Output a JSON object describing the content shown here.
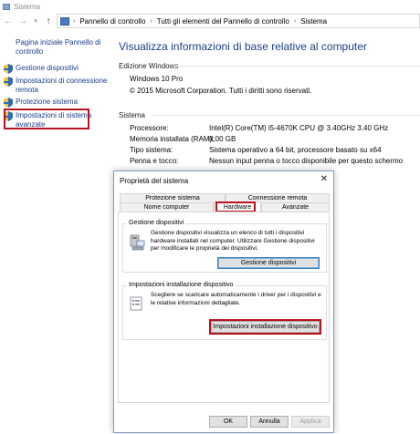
{
  "window": {
    "title": "Sistema"
  },
  "breadcrumb": {
    "items": [
      "Pannello di controllo",
      "Tutti gli elementi del Pannello di controllo",
      "Sistema"
    ]
  },
  "left": {
    "home": "Pagina iniziale Pannello di controllo",
    "links": [
      "Gestione dispositivi",
      "Impostazioni di connessione remota",
      "Protezione sistema",
      "Impostazioni di sistema avanzate"
    ]
  },
  "main": {
    "title": "Visualizza informazioni di base relative al computer",
    "edition": {
      "label": "Edizione Windows",
      "name": "Windows 10 Pro",
      "copyright": "© 2015 Microsoft Corporation. Tutti i diritti sono riservati."
    },
    "system": {
      "label": "Sistema",
      "rows": [
        {
          "label": "Processore:",
          "value": "Intel(R) Core(TM) i5-4670K CPU @ 3.40GHz   3.40 GHz"
        },
        {
          "label": "Memoria installata (RAM):",
          "value": "8,00 GB"
        },
        {
          "label": "Tipo sistema:",
          "value": "Sistema operativo a 64 bit, processore basato su x64"
        },
        {
          "label": "Penna e tocco:",
          "value": "Nessun input penna o tocco disponibile per questo schermo"
        }
      ]
    }
  },
  "dialog": {
    "title": "Proprietà del sistema",
    "close": "✕",
    "tabs_top": [
      "Protezione sistema",
      "Connessione remota"
    ],
    "tabs_bottom": [
      "Nome computer",
      "Hardware",
      "Avanzate"
    ],
    "device_manager": {
      "title": "Gestione dispositivi",
      "text": "Gestione dispositivi visualizza un elenco di tutti i dispositivi hardware installati nel computer. Utilizzare Gestione dispositivi per modificare le proprietà dei dispositivi.",
      "button": "Gestione dispositivi"
    },
    "device_install": {
      "title": "Impostazioni installazione dispositivo",
      "text": "Scegliere se scaricare automaticamente i driver per i dispositivi e le relative informazioni dettagliate.",
      "button": "Impostazioni installazione dispositivo"
    },
    "buttons": {
      "ok": "OK",
      "cancel": "Annulla",
      "apply": "Applica"
    }
  },
  "colors": {
    "link": "#1a3d8c",
    "title": "#1b3f87",
    "highlight": "#b8121e",
    "dialog_border": "#7c9ec3"
  }
}
